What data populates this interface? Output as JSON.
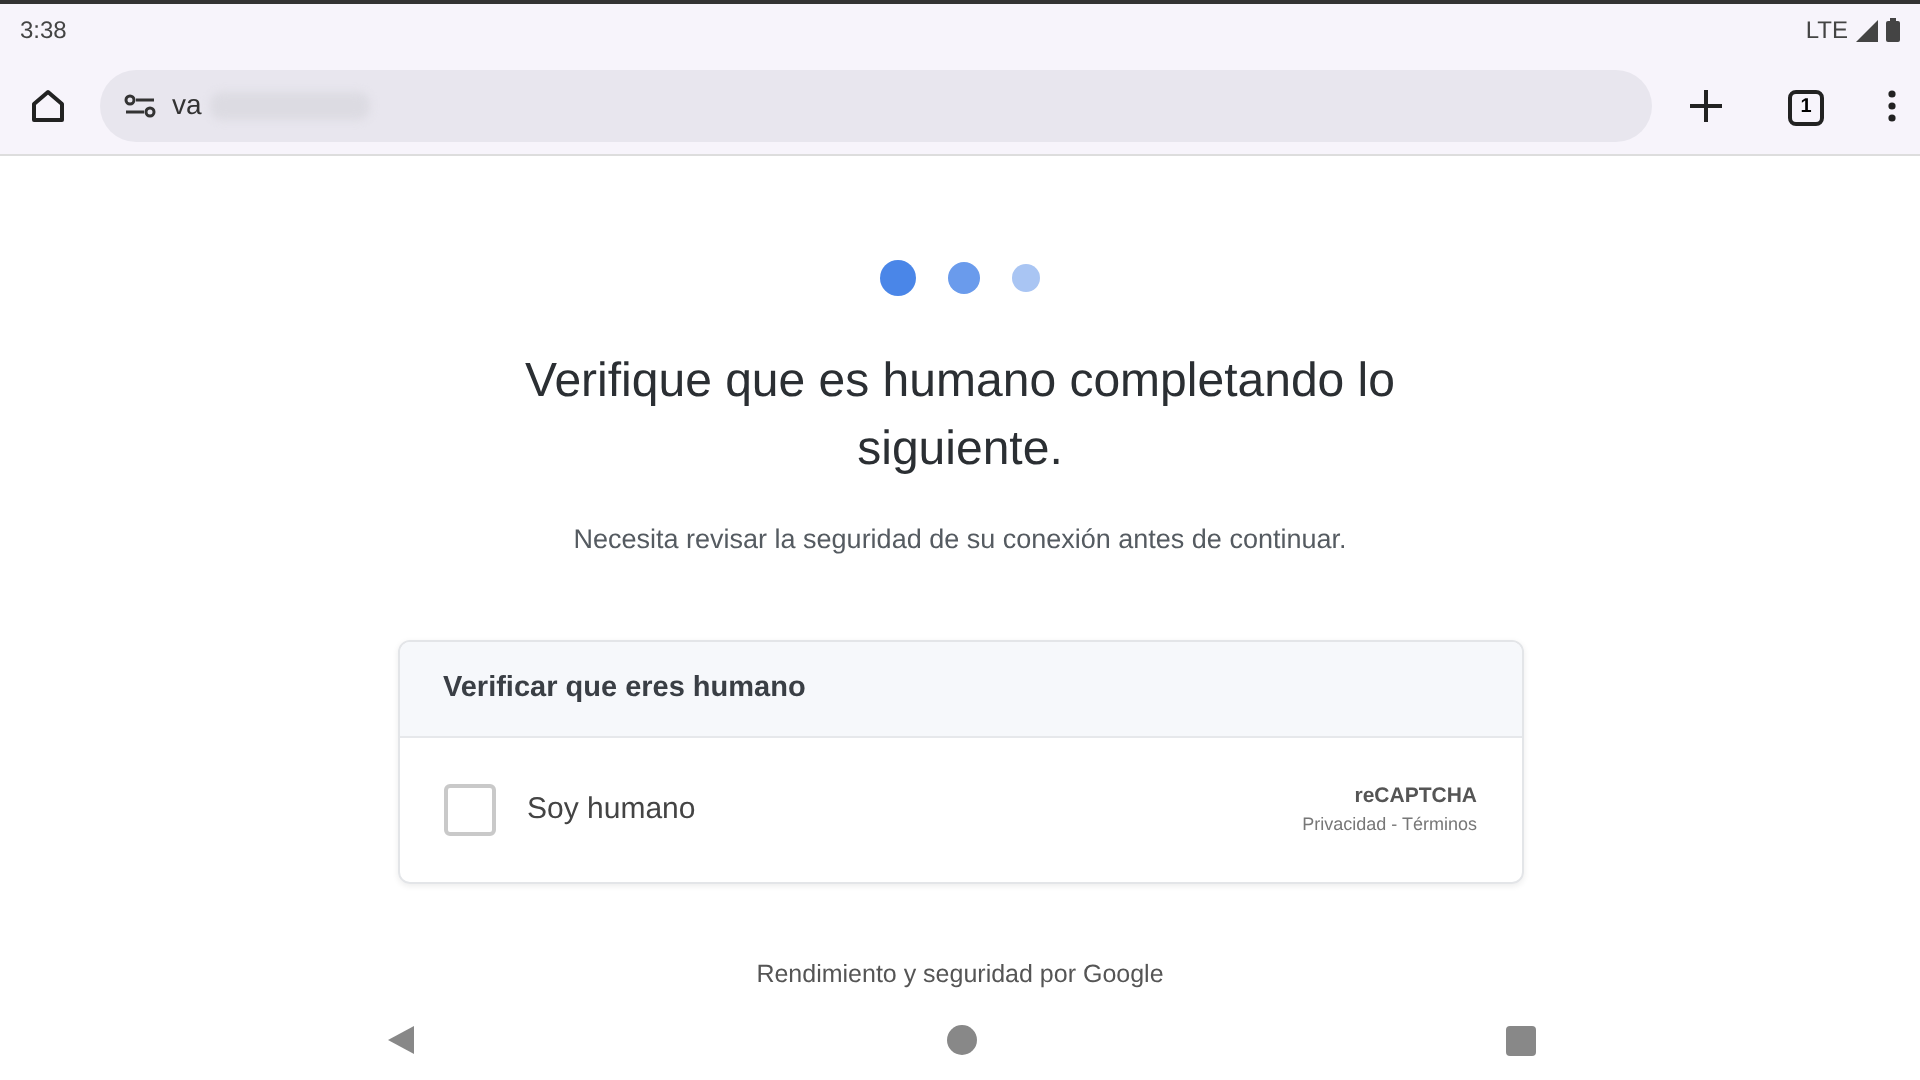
{
  "status_bar": {
    "time": "3:38",
    "network": "LTE"
  },
  "browser": {
    "url": "va",
    "tab_count": "1"
  },
  "loader_dots": [
    {
      "color": "#4a86e8"
    },
    {
      "color": "#6a9bec"
    },
    {
      "color": "#a9c5f3"
    }
  ],
  "heading": "Verifique que es humano completando lo siguiente.",
  "subtitle": "Necesita revisar la seguridad de su conexión antes de continuar.",
  "captcha_card": {
    "title": "Verificar que eres humano",
    "checkbox": {
      "label": "Soy humano",
      "checked": false
    },
    "brand": "reCAPTCHA",
    "links": "Privacidad - Términos"
  },
  "footer": "Rendimiento y seguridad por Google"
}
